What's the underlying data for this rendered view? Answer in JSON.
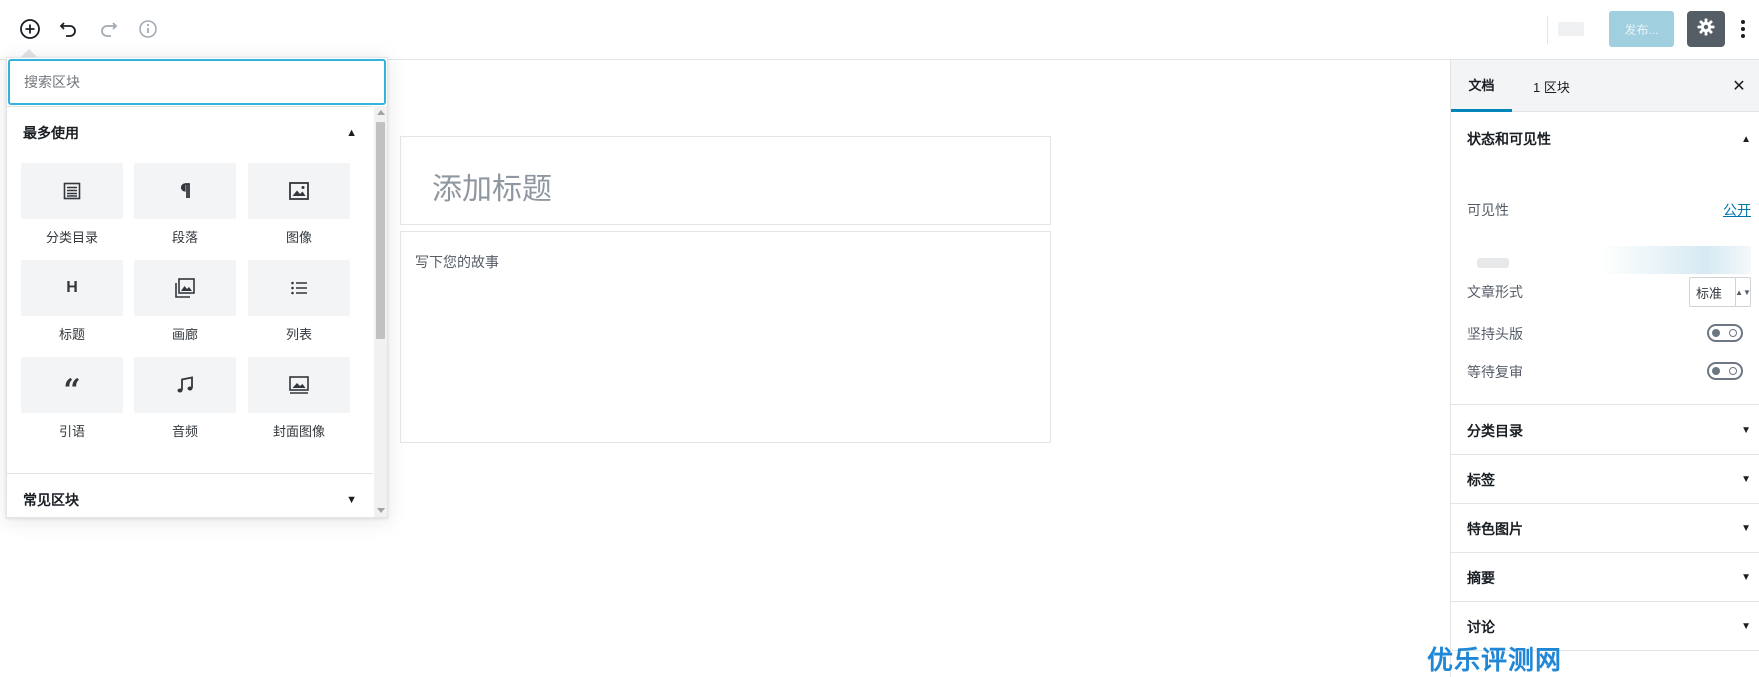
{
  "toolbar": {
    "add_icon": "plus-circle-icon",
    "undo_icon": "undo-icon",
    "redo_icon": "redo-icon",
    "info_icon": "info-icon",
    "publish_label": "发布...",
    "settings_icon": "gear-icon",
    "more_icon": "vertical-ellipsis-icon",
    "accent_color": "#555d66",
    "publish_color": "#a0cfe0"
  },
  "inserter": {
    "search_placeholder": "搜索区块",
    "most_used": {
      "title": "最多使用",
      "expanded": true,
      "items": [
        {
          "label": "分类目录",
          "icon": "categories-icon"
        },
        {
          "label": "段落",
          "icon": "paragraph-icon"
        },
        {
          "label": "图像",
          "icon": "image-icon"
        },
        {
          "label": "标题",
          "icon": "heading-icon"
        },
        {
          "label": "画廊",
          "icon": "gallery-icon"
        },
        {
          "label": "列表",
          "icon": "list-icon"
        },
        {
          "label": "引语",
          "icon": "quote-icon"
        },
        {
          "label": "音频",
          "icon": "audio-icon"
        },
        {
          "label": "封面图像",
          "icon": "cover-image-icon"
        }
      ]
    },
    "common_blocks": {
      "title": "常见区块",
      "expanded": false
    }
  },
  "editor": {
    "title_placeholder": "添加标题",
    "body_placeholder": "写下您的故事"
  },
  "sidebar": {
    "tabs": [
      {
        "label": "文档",
        "active": true
      },
      {
        "label": "1 区块",
        "active": false
      }
    ],
    "close_icon": "close-icon",
    "status": {
      "title": "状态和可见性",
      "expanded": true,
      "visibility_label": "可见性",
      "visibility_value": "公开",
      "format_label": "文章形式",
      "format_value": "标准",
      "sticky_label": "坚持头版",
      "sticky_on": false,
      "pending_label": "等待复审",
      "pending_on": false
    },
    "sections": [
      {
        "title": "分类目录",
        "expanded": false
      },
      {
        "title": "标签",
        "expanded": false
      },
      {
        "title": "特色图片",
        "expanded": false
      },
      {
        "title": "摘要",
        "expanded": false
      },
      {
        "title": "讨论",
        "expanded": false
      }
    ],
    "tab_active_color": "#0085ba",
    "link_color": "#0073aa"
  },
  "watermark": "优乐评测网"
}
